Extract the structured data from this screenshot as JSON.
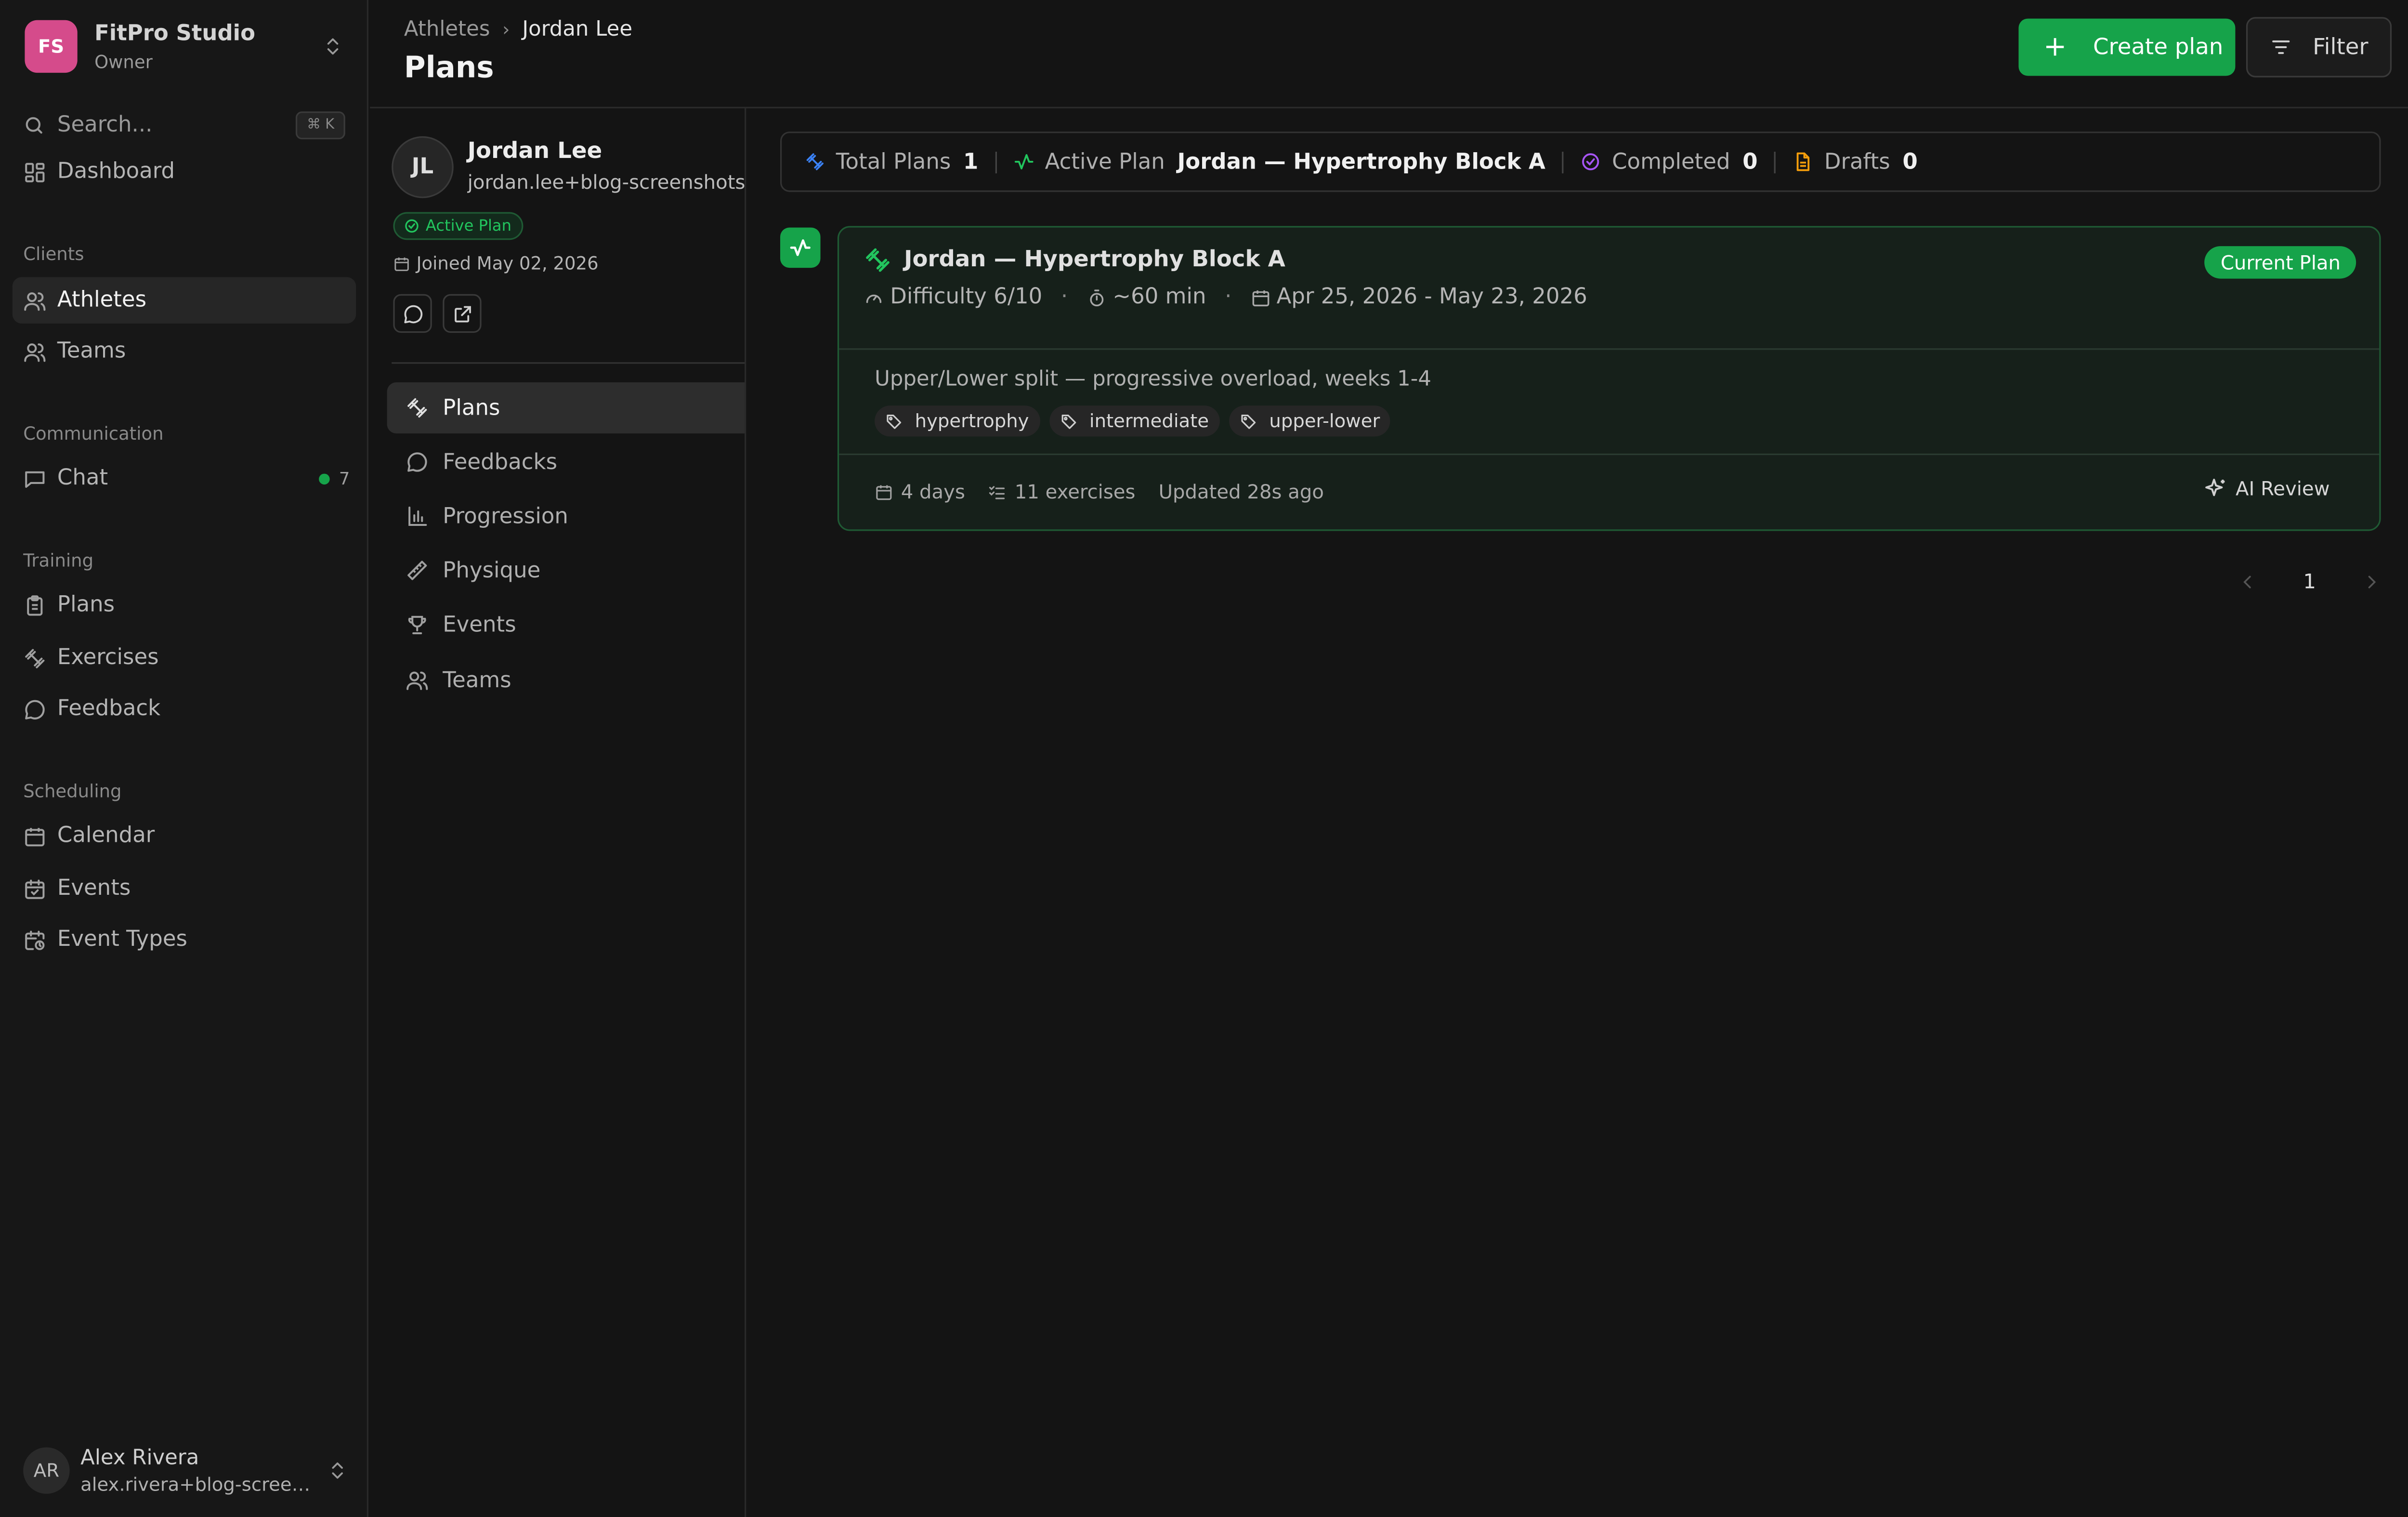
{
  "org": {
    "initials": "FS",
    "name": "FitPro Studio",
    "role": "Owner"
  },
  "search": {
    "label": "Search...",
    "shortcut": "⌘ K"
  },
  "nav": {
    "dashboard": "Dashboard",
    "clients_label": "Clients",
    "athletes": "Athletes",
    "teams": "Teams",
    "communication_label": "Communication",
    "chat": "Chat",
    "chat_count": "7",
    "training_label": "Training",
    "plans": "Plans",
    "exercises": "Exercises",
    "feedback": "Feedback",
    "scheduling_label": "Scheduling",
    "calendar": "Calendar",
    "events": "Events",
    "event_types": "Event Types"
  },
  "user": {
    "initials": "AR",
    "name": "Alex Rivera",
    "email": "alex.rivera+blog-screenshots@"
  },
  "header": {
    "breadcrumb": [
      "Athletes",
      "Jordan Lee"
    ],
    "title": "Plans",
    "create_label": "Create plan",
    "filter_label": "Filter"
  },
  "athlete": {
    "initials": "JL",
    "name": "Jordan Lee",
    "email": "jordan.lee+blog-screenshots@",
    "status": "Active Plan",
    "joined": "Joined May 02, 2026",
    "tabs": [
      "Plans",
      "Feedbacks",
      "Progression",
      "Physique",
      "Events",
      "Teams"
    ]
  },
  "stats": {
    "total_label": "Total Plans",
    "total_value": "1",
    "active_label": "Active Plan",
    "active_value": "Jordan — Hypertrophy Block A",
    "completed_label": "Completed",
    "completed_value": "0",
    "drafts_label": "Drafts",
    "drafts_value": "0"
  },
  "plan": {
    "title": "Jordan — Hypertrophy Block A",
    "badge": "Current Plan",
    "difficulty": "Difficulty 6/10",
    "duration": "~60 min",
    "dates": "Apr 25, 2026 - May 23, 2026",
    "description": "Upper/Lower split — progressive overload, weeks 1-4",
    "tags": [
      "hypertrophy",
      "intermediate",
      "upper-lower"
    ],
    "days": "4 days",
    "exercises": "11 exercises",
    "updated": "Updated 28s ago",
    "ai_review": "AI Review"
  },
  "pagination": {
    "current": "1"
  },
  "colors": {
    "accent": "#16a34a",
    "org_logo": "#d54b8b",
    "background": "#141414"
  }
}
